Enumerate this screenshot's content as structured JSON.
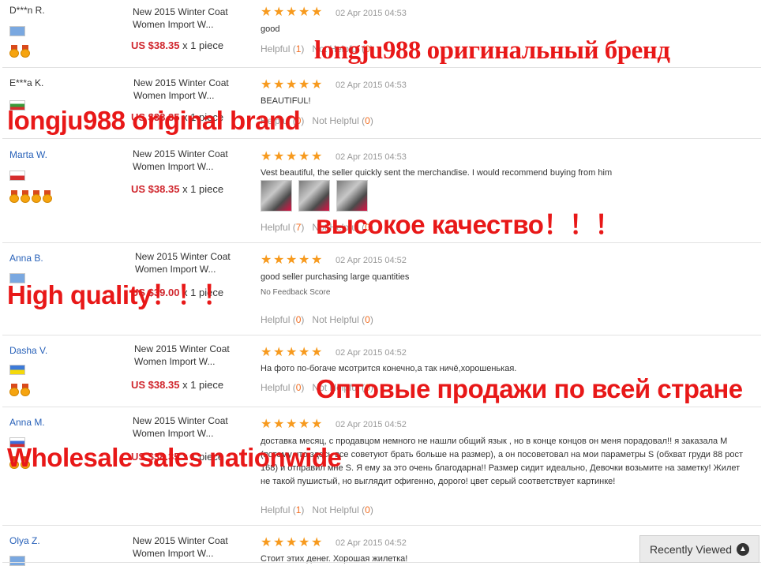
{
  "rows": [
    {
      "buyer": "D***n R.",
      "product": [
        "New 2015 Winter Coat",
        "Women Import W..."
      ],
      "price": "US $38.35",
      "qty": "x 1 piece",
      "date": "02 Apr 2015 04:53",
      "feedback": "good",
      "helpful": "1",
      "not_helpful": "0"
    },
    {
      "buyer": "E***a K.",
      "product": [
        "New 2015 Winter Coat",
        "Women Import W..."
      ],
      "price": "US $38.35",
      "qty": "x 1 piece",
      "date": "02 Apr 2015 04:53",
      "feedback": "BEAUTIFUL!",
      "helpful": "0",
      "not_helpful": "0"
    },
    {
      "buyer": "Marta W.",
      "product": [
        "New 2015 Winter Coat",
        "Women Import W..."
      ],
      "price": "US $38.35",
      "qty": "x 1 piece",
      "date": "02 Apr 2015 04:53",
      "feedback": "Vest beautiful, the seller quickly sent the merchandise. I would recommend buying from him",
      "helpful": "7",
      "not_helpful": "0"
    },
    {
      "buyer": "Anna B.",
      "product": [
        "New 2015 Winter Coat",
        "Women Import W..."
      ],
      "price": "US $39.00",
      "qty": "x 1 piece",
      "date": "02 Apr 2015 04:52",
      "feedback": "good seller purchasing large quantities",
      "no_feedback_score": "No Feedback Score",
      "helpful": "0",
      "not_helpful": "0"
    },
    {
      "buyer": "Dasha V.",
      "product": [
        "New 2015 Winter Coat",
        "Women Import W..."
      ],
      "price": "US $38.35",
      "qty": "x 1 piece",
      "date": "02 Apr 2015 04:52",
      "feedback": "На фото по-богаче мсотрится конечно,а так ничё,хорошенькая.",
      "helpful": "0",
      "not_helpful": "0"
    },
    {
      "buyer": "Anna M.",
      "product": [
        "New 2015 Winter Coat",
        "Women Import W..."
      ],
      "price": "US $38.35",
      "qty": "x 1 piece",
      "date": "02 Apr 2015 04:52",
      "feedback": "доставка месяц, с продавцом немного не нашли общий язык , но в конце концов он меня порадовал!! я заказала М (потому что здесь все советуют брать больше на размер), а он посоветовал на мои параметры S (обхват груди 88 рост 168) и отправил мне S. Я ему за это очень благодарна!! Размер сидит идеально, Девочки возьмите на заметку! Жилет не такой пушистый, но выглядит офигенно, дорого! цвет серый соответствует картинке!",
      "helpful": "1",
      "not_helpful": "0"
    },
    {
      "buyer": "Olya Z.",
      "product": [
        "New 2015 Winter Coat",
        "Women Import W..."
      ],
      "date": "02 Apr 2015 04:52",
      "feedback": "Стоит этих денег. Хорошая жилетка!"
    }
  ],
  "labels": {
    "helpful": "Helpful",
    "not_helpful": "Not Helpful",
    "open": "(",
    "close": ")"
  },
  "watermarks": {
    "w1": "longju988 оригинальный бренд",
    "w2": "longju988 original brand",
    "w3": "высокое качество！！！",
    "w4": "High quality！！！",
    "w5": "Оптовые продажи по всей стране",
    "w6": "Wholesale sales nationwide"
  },
  "recently_viewed": "Recently Viewed",
  "colors": {
    "accent": "#d0262d",
    "star": "#f79a1e",
    "link": "#2962b9",
    "watermark": "#e81818"
  }
}
